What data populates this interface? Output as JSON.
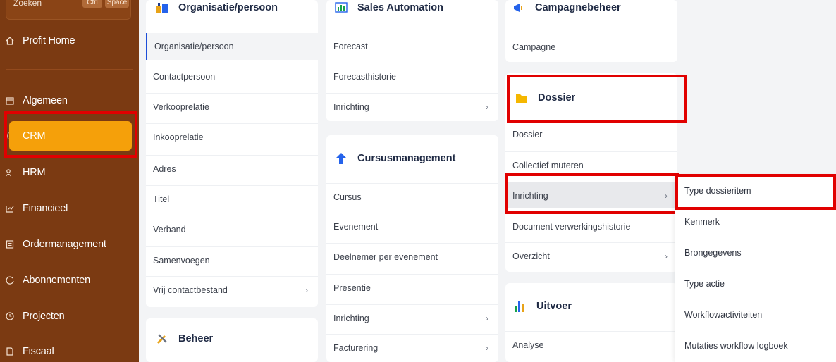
{
  "sidebar": {
    "search_label": "Zoeken",
    "search_kbd_1": "Ctrl",
    "search_kbd_2": "Space",
    "items": [
      {
        "label": "Profit Home",
        "icon": "home-icon"
      },
      {
        "label": "Algemeen",
        "icon": "calendar-icon"
      },
      {
        "label": "CRM",
        "icon": "crm-icon"
      },
      {
        "label": "HRM",
        "icon": "people-icon"
      },
      {
        "label": "Financieel",
        "icon": "chart-icon"
      },
      {
        "label": "Ordermanagement",
        "icon": "order-icon"
      },
      {
        "label": "Abonnementen",
        "icon": "refresh-icon"
      },
      {
        "label": "Projecten",
        "icon": "clock-icon"
      },
      {
        "label": "Fiscaal",
        "icon": "document-icon"
      }
    ]
  },
  "col1": {
    "title": "Organisatie/persoon",
    "items": [
      "Organisatie/persoon",
      "Contactpersoon",
      "Verkooprelatie",
      "Inkooprelatie",
      "Adres",
      "Titel",
      "Verband",
      "Samenvoegen",
      "Vrij contactbestand"
    ],
    "beheer_title": "Beheer"
  },
  "col2": {
    "sales_title": "Sales Automation",
    "sales_items": [
      "Forecast",
      "Forecasthistorie",
      "Inrichting"
    ],
    "cursus_title": "Cursusmanagement",
    "cursus_items": [
      "Cursus",
      "Evenement",
      "Deelnemer per evenement",
      "Presentie",
      "Inrichting",
      "Facturering"
    ]
  },
  "col3": {
    "campagne_title": "Campagnebeheer",
    "campagne_items": [
      "Campagne"
    ],
    "dossier_title": "Dossier",
    "dossier_items": [
      "Dossier",
      "Collectief muteren",
      "Inrichting",
      "Document verwerkingshistorie",
      "Overzicht"
    ],
    "uitvoer_title": "Uitvoer",
    "uitvoer_items": [
      "Analyse"
    ]
  },
  "submenu": {
    "items": [
      "Type dossieritem",
      "Kenmerk",
      "Brongegevens",
      "Type actie",
      "Workflowactiviteiten",
      "Mutaties workflow logboek"
    ]
  },
  "colors": {
    "sidebar": "#7b3a12",
    "accent": "#f5a00a",
    "highlight": "#e10000"
  }
}
